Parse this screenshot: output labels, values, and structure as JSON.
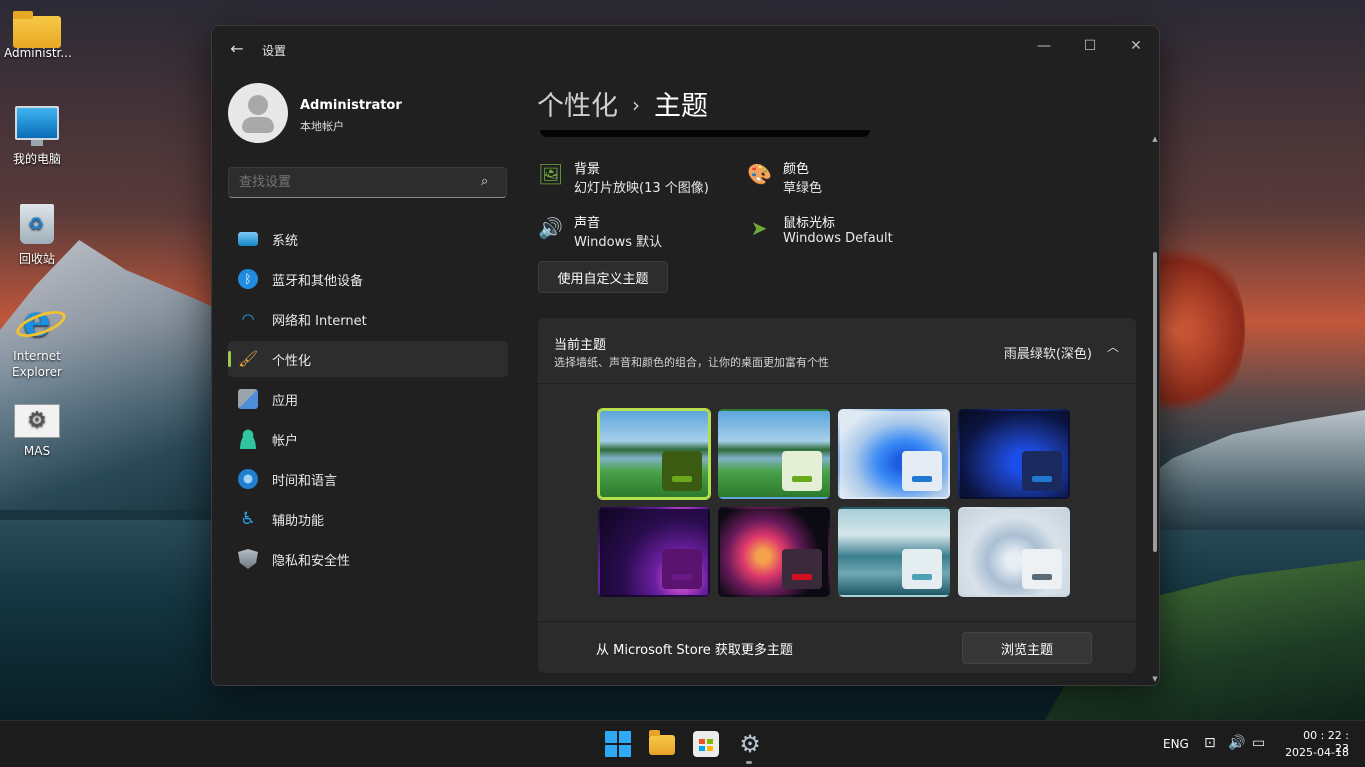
{
  "desktop": {
    "icons": [
      {
        "label": "Administr...",
        "icon": "folder-icon"
      },
      {
        "label": "我的电脑",
        "icon": "computer-icon"
      },
      {
        "label": "回收站",
        "icon": "recycle-bin-icon"
      },
      {
        "label": "Internet Explorer",
        "icon": "internet-explorer-icon"
      },
      {
        "label": "MAS",
        "icon": "mas-icon"
      }
    ]
  },
  "window": {
    "title": "设置",
    "back_icon": "←",
    "minimize_icon": "—",
    "maximize_icon": "☐",
    "close_icon": "✕"
  },
  "profile": {
    "name": "Administrator",
    "subtitle": "本地帐户"
  },
  "search": {
    "placeholder": "查找设置",
    "icon": "⌕"
  },
  "nav": {
    "items": [
      {
        "label": "系统",
        "icon": "system-icon"
      },
      {
        "label": "蓝牙和其他设备",
        "icon": "bluetooth-icon"
      },
      {
        "label": "网络和 Internet",
        "icon": "wifi-icon"
      },
      {
        "label": "个性化",
        "icon": "brush-icon",
        "active": true
      },
      {
        "label": "应用",
        "icon": "apps-icon"
      },
      {
        "label": "帐户",
        "icon": "account-icon"
      },
      {
        "label": "时间和语言",
        "icon": "time-language-icon"
      },
      {
        "label": "辅助功能",
        "icon": "accessibility-icon"
      },
      {
        "label": "隐私和安全性",
        "icon": "shield-icon"
      }
    ],
    "glyphs": {
      "bluetooth": "ᛒ",
      "wifi": "◠",
      "brush": "🖌",
      "access": "♿"
    }
  },
  "breadcrumb": {
    "parent": "个性化",
    "separator": "›",
    "current": "主题"
  },
  "props": {
    "background": {
      "title": "背景",
      "value": "幻灯片放映(13 个图像)",
      "icon_glyph": "🖼"
    },
    "color": {
      "title": "颜色",
      "value": "草绿色",
      "icon_glyph": "🎨"
    },
    "sound": {
      "title": "声音",
      "value": "Windows 默认",
      "icon_glyph": "🔊"
    },
    "cursor": {
      "title": "鼠标光标",
      "value": "Windows Default",
      "icon_glyph": "➤"
    }
  },
  "custom_button": "使用自定义主题",
  "current_theme": {
    "title": "当前主题",
    "subtitle": "选择墙纸、声音和颜色的组合，让你的桌面更加富有个性",
    "value": "雨晨绿软(深色)",
    "chevron": "︿",
    "themes": [
      {
        "accent": "#6aa91c",
        "swatch": "#3b5a12",
        "selected": true
      },
      {
        "accent": "#6aa91c",
        "swatch": "#e4efd6"
      },
      {
        "accent": "#1f78d1",
        "swatch": "#e6ecf4"
      },
      {
        "accent": "#1f78d1",
        "swatch": "#1b2a5e"
      },
      {
        "accent": "#6a1a86",
        "swatch": "#5a1470"
      },
      {
        "accent": "#d4101f",
        "swatch": "#3a2a3a"
      },
      {
        "accent": "#4aa2b4",
        "swatch": "#e4eef1"
      },
      {
        "accent": "#5a6a78",
        "swatch": "#eef1f4"
      }
    ]
  },
  "store": {
    "text": "从 Microsoft Store 获取更多主题",
    "button": "浏览主题"
  },
  "scrollbar": {
    "up": "▲",
    "down": "▼"
  },
  "taskbar": {
    "lang": "ENG",
    "time": "00 : 22 : 23",
    "date": "2025-04-18",
    "net_glyph": "⊡",
    "vol_glyph": "🔊",
    "bat_glyph": "▭",
    "settings_glyph": "⚙"
  },
  "colors": {
    "accent": "#9dc84a",
    "selected_border": "#b5e04b",
    "window_bg": "#202020"
  }
}
